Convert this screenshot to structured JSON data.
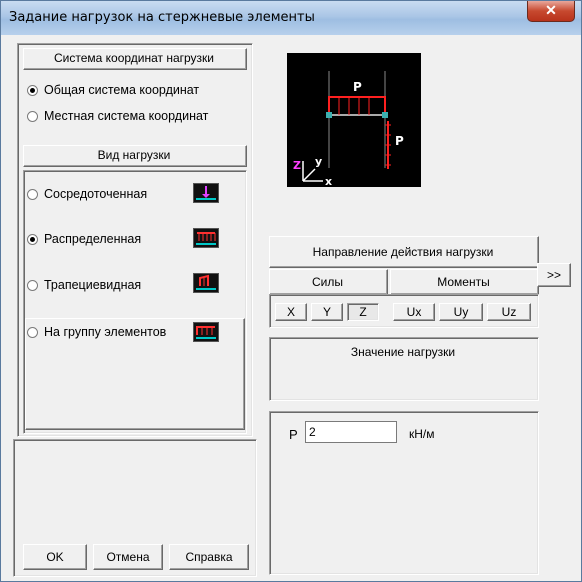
{
  "window": {
    "title": "Задание нагрузок на стержневые элементы",
    "close": "✕"
  },
  "coord_system": {
    "header": "Система координат нагрузки",
    "options": [
      {
        "label": "Общая система координат",
        "selected": true
      },
      {
        "label": "Местная  система координат",
        "selected": false
      }
    ]
  },
  "load_type": {
    "header": "Вид нагрузки",
    "options": [
      {
        "label": "Сосредоточенная",
        "selected": false,
        "icon": "concentrated-load-icon"
      },
      {
        "label": "Распределенная",
        "selected": true,
        "icon": "distributed-load-icon"
      },
      {
        "label": "Трапециевидная",
        "selected": false,
        "icon": "trapezoidal-load-icon"
      },
      {
        "label": "На группу элементов",
        "selected": false,
        "icon": "group-load-icon"
      }
    ]
  },
  "diagram": {
    "p_label": "P",
    "p_label2": "P",
    "axis_z": "Z",
    "axis_y": "y",
    "axis_x": "x"
  },
  "direction": {
    "header": "Направление действия нагрузки",
    "forces_label": "Силы",
    "moments_label": "Моменты",
    "force_buttons": [
      "X",
      "Y",
      "Z"
    ],
    "moment_buttons": [
      "Ux",
      "Uy",
      "Uz"
    ],
    "pressed": "Z",
    "expand": ">>"
  },
  "value": {
    "header": "Значение нагрузки",
    "p_label": "P",
    "p_value": "2",
    "unit": "кН/м"
  },
  "footer": {
    "ok": "OK",
    "cancel": "Отмена",
    "help": "Справка"
  }
}
